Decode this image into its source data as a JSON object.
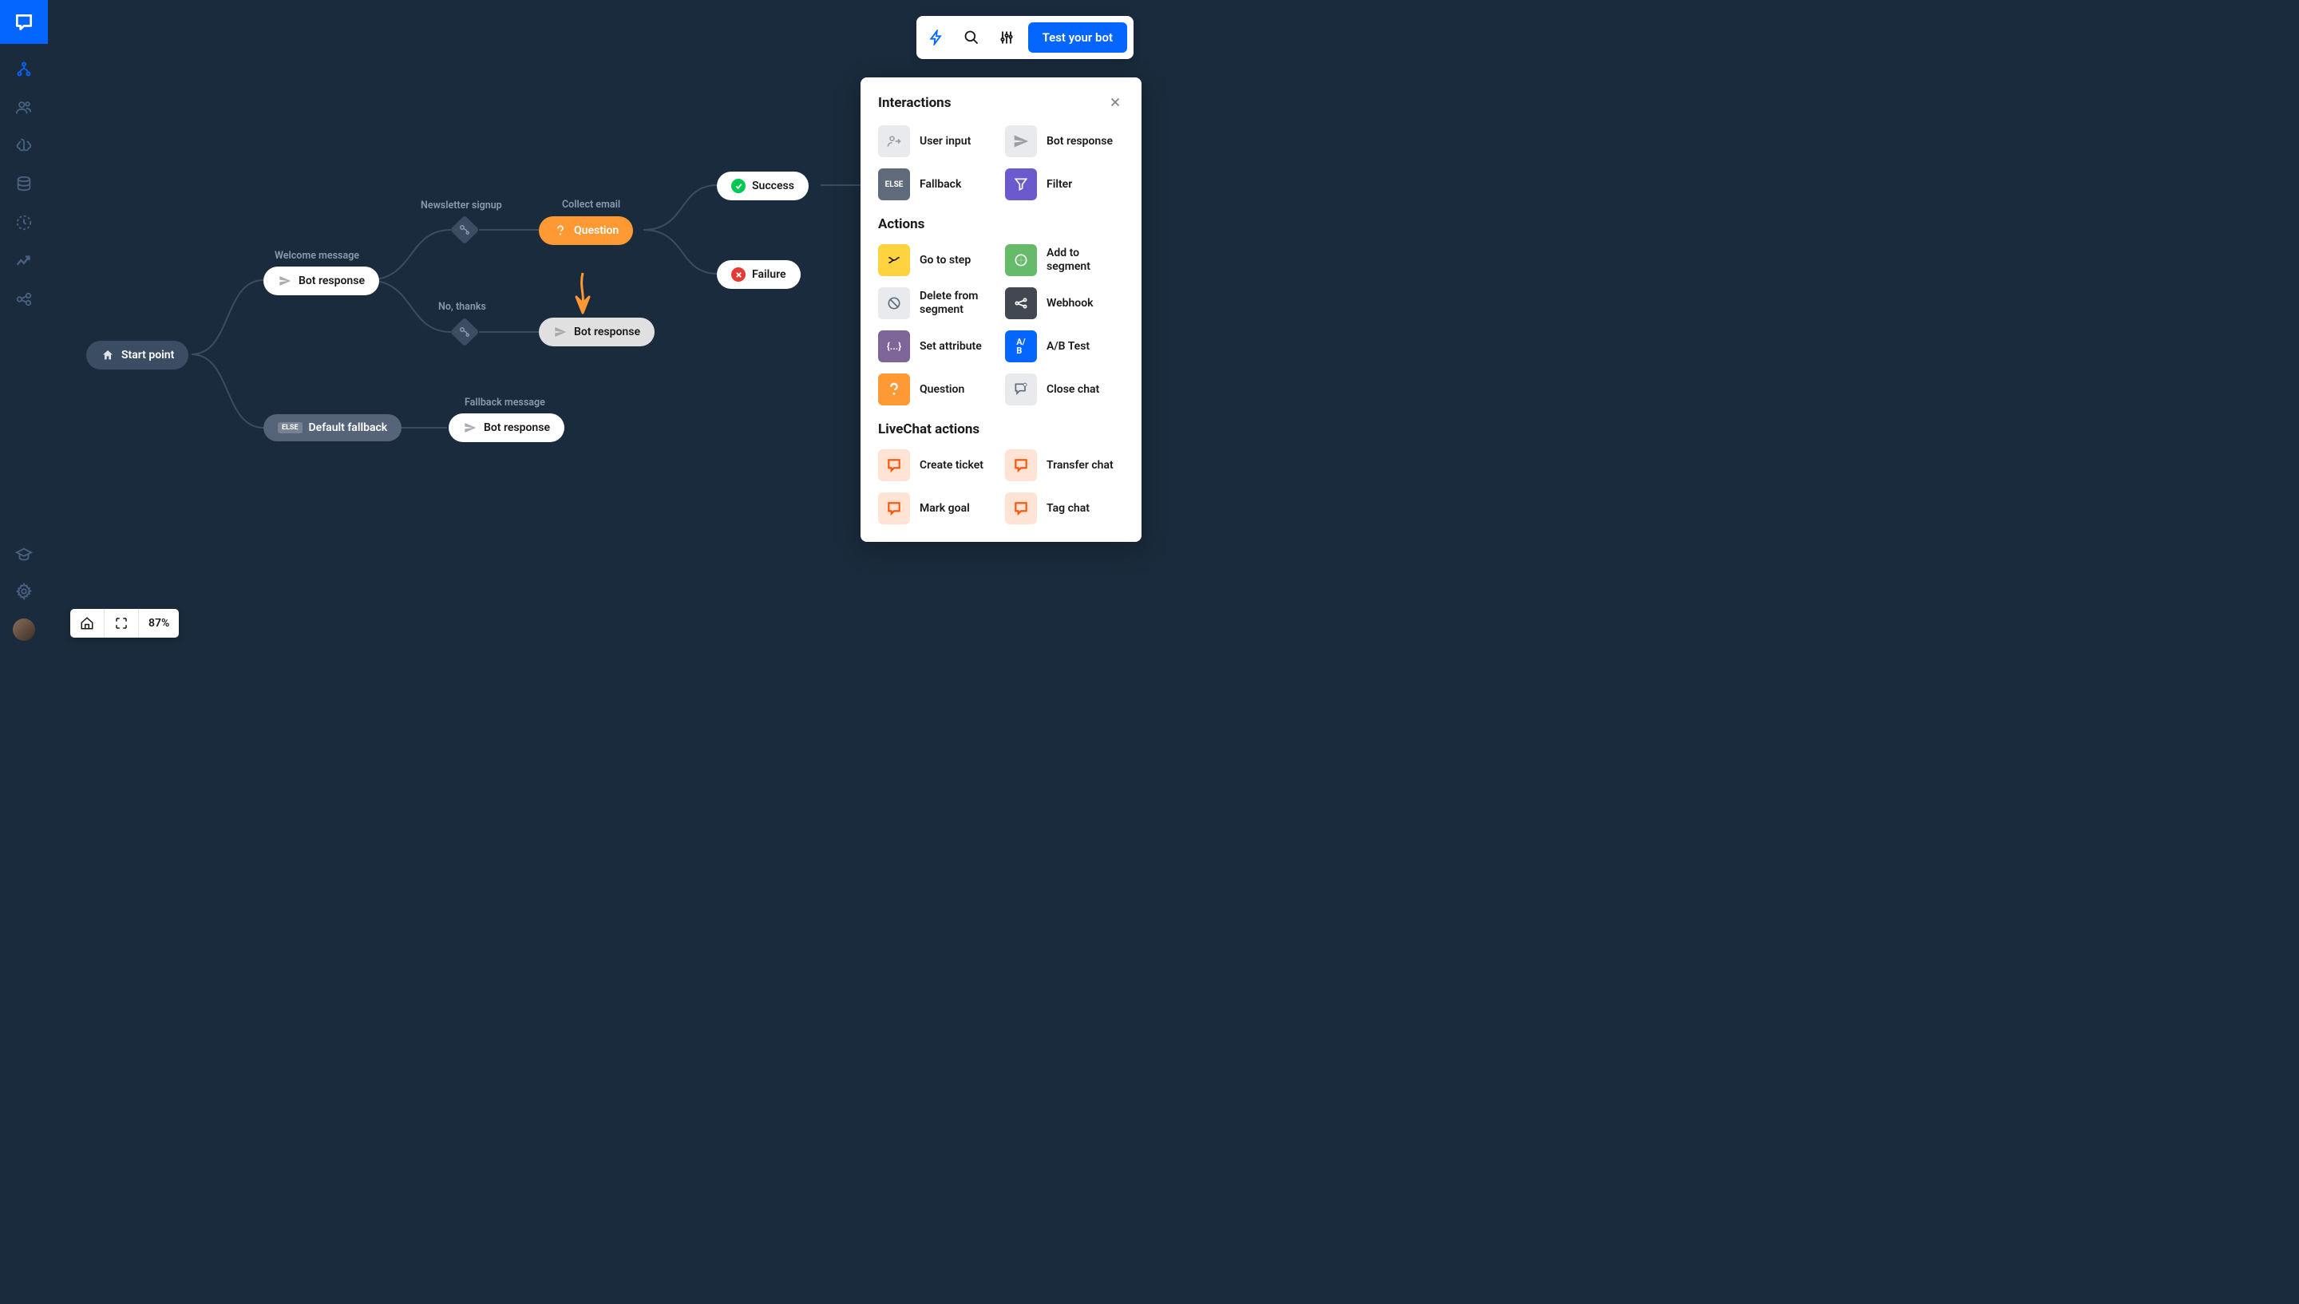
{
  "topbar": {
    "test_button_label": "Test your bot"
  },
  "sidebar": {
    "icons": [
      "flow",
      "users",
      "brain",
      "database",
      "clock",
      "trends",
      "webhooks"
    ],
    "bottom_icons": [
      "academy",
      "settings"
    ]
  },
  "canvas": {
    "nodes": {
      "start": {
        "label": "Start point"
      },
      "welcome": {
        "title": "Welcome message",
        "label": "Bot response"
      },
      "newsletter": {
        "title": "Newsletter signup"
      },
      "nothanks": {
        "title": "No, thanks"
      },
      "collect": {
        "title": "Collect email",
        "label": "Question"
      },
      "botresp2": {
        "label": "Bot response"
      },
      "success": {
        "label": "Success"
      },
      "failure": {
        "label": "Failure"
      },
      "fallback": {
        "label": "Default fallback",
        "badge": "ELSE"
      },
      "fallback_msg": {
        "title": "Fallback message",
        "label": "Bot response"
      }
    }
  },
  "panel": {
    "sections": {
      "interactions": {
        "title": "Interactions",
        "items": [
          {
            "label": "User input",
            "icon": "user-input",
            "bg": "#e8eaed",
            "fg": "#9aa0a6"
          },
          {
            "label": "Bot response",
            "icon": "send",
            "bg": "#e8eaed",
            "fg": "#9aa0a6"
          },
          {
            "label": "Fallback",
            "icon": "else",
            "bg": "#5f6b7a",
            "fg": "#fff"
          },
          {
            "label": "Filter",
            "icon": "filter",
            "bg": "#6a5acd",
            "fg": "#fff"
          }
        ]
      },
      "actions": {
        "title": "Actions",
        "items": [
          {
            "label": "Go to step",
            "icon": "goto",
            "bg": "#ffd23f",
            "fg": "#1a1a1a"
          },
          {
            "label": "Add to segment",
            "icon": "segment-add",
            "bg": "#66bb6a",
            "fg": "#fff"
          },
          {
            "label": "Delete from segment",
            "icon": "segment-del",
            "bg": "#e8eaed",
            "fg": "#5f6b7a"
          },
          {
            "label": "Webhook",
            "icon": "webhook",
            "bg": "#424852",
            "fg": "#fff"
          },
          {
            "label": "Set attribute",
            "icon": "attribute",
            "bg": "#7e6599",
            "fg": "#fff"
          },
          {
            "label": "A/B Test",
            "icon": "abtest",
            "bg": "#0566ff",
            "fg": "#fff"
          },
          {
            "label": "Question",
            "icon": "question",
            "bg": "#ff9933",
            "fg": "#fff"
          },
          {
            "label": "Close chat",
            "icon": "close-chat",
            "bg": "#e8eaed",
            "fg": "#5f6b7a"
          }
        ]
      },
      "livechat": {
        "title": "LiveChat actions",
        "items": [
          {
            "label": "Create ticket",
            "icon": "chat",
            "bg": "#ffe3d5",
            "fg": "#ff5100"
          },
          {
            "label": "Transfer chat",
            "icon": "chat",
            "bg": "#ffe3d5",
            "fg": "#ff5100"
          },
          {
            "label": "Mark goal",
            "icon": "chat",
            "bg": "#ffe3d5",
            "fg": "#ff5100"
          },
          {
            "label": "Tag chat",
            "icon": "chat",
            "bg": "#ffe3d5",
            "fg": "#ff5100"
          }
        ]
      }
    }
  },
  "bottom": {
    "zoom": "87%"
  }
}
